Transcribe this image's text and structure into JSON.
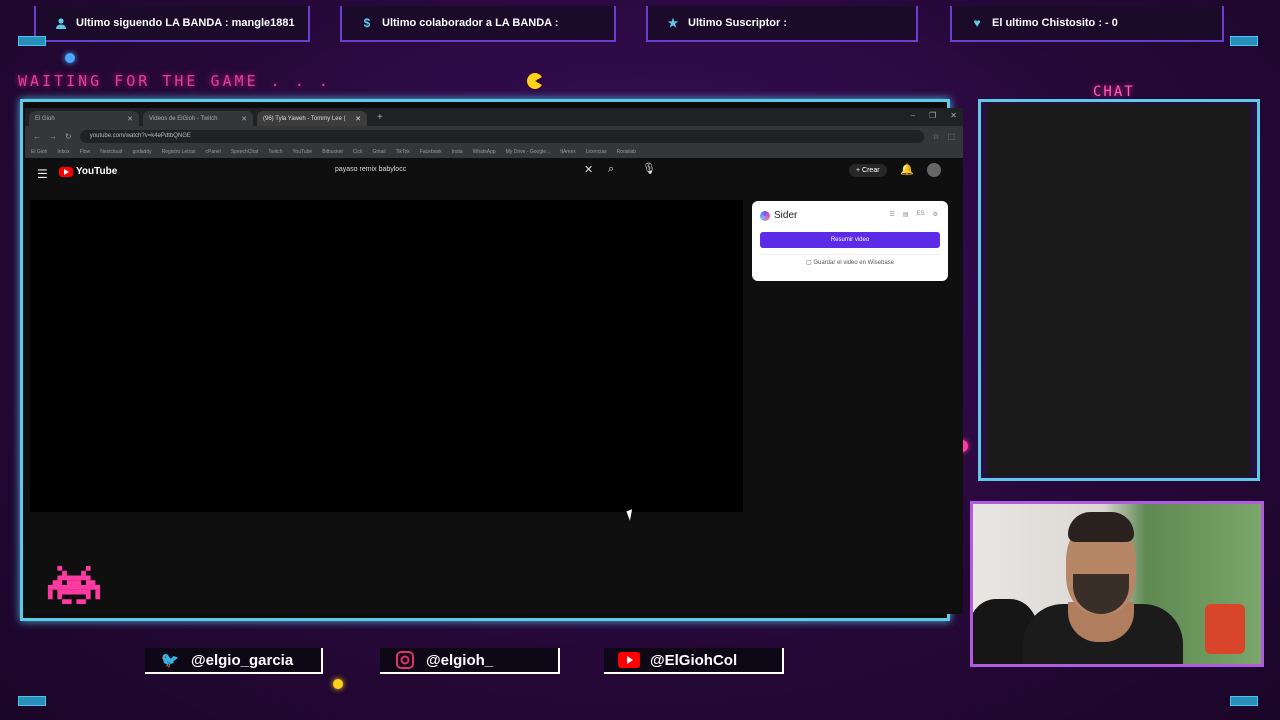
{
  "alerts": [
    {
      "icon": "user-icon",
      "text": "Ultimo siguendo LA BANDA : mangle1881"
    },
    {
      "icon": "dollar-icon",
      "text": "Ultimo colaborador a LA BANDA :"
    },
    {
      "icon": "star-icon",
      "text": "Ultimo Suscriptor :"
    },
    {
      "icon": "heart-icon",
      "text": "El ultimo Chistosito :  - 0"
    }
  ],
  "overlay": {
    "waiting": "WAITING FOR THE GAME . . .",
    "chat_label": "CHAT"
  },
  "browser": {
    "tabs": [
      {
        "title": "El Gioh",
        "active": false
      },
      {
        "title": "Videos de ElGioh - Twitch",
        "active": false
      },
      {
        "title": "(96) Tyla Yaweh - Tommy Lee (",
        "active": true
      }
    ],
    "url": "youtube.com/watch?v=k4ePdtbQNGE",
    "bookmarks": [
      "El Gioh",
      "Inbox",
      "Flow",
      "Nextcloud",
      "godaddy",
      "Registro Letras",
      "cPanel",
      "SpeechChat",
      "Twitch",
      "YouTube",
      "Bitbucket",
      "Cick",
      "Gmail",
      "TikTok",
      "Facebook",
      "Insta",
      "WhatsApp",
      "My Drive - Google...",
      "ItAmex",
      "Licencias",
      "Roosilab"
    ]
  },
  "youtube": {
    "logo_text": "YouTube",
    "search_value": "payaso remix babylocc",
    "create_label": "Crear",
    "notifications_badge": "9+"
  },
  "sider": {
    "title": "Sider",
    "lang": "ES",
    "summarize_label": "Resumir video",
    "save_label": "Guardar el video en Wisebase"
  },
  "socials": [
    {
      "icon": "twitter-icon",
      "handle": "@elgio_garcia",
      "color": "#1da1f2"
    },
    {
      "icon": "instagram-icon",
      "handle": "@elgioh_",
      "color": "#e1306c"
    },
    {
      "icon": "youtube-icon",
      "handle": "@ElGiohCol",
      "color": "#ff0000"
    }
  ],
  "colors": {
    "frame": "#5fc9e8",
    "accent_pink": "#ff4aa8",
    "sider_button": "#5b2be8"
  }
}
